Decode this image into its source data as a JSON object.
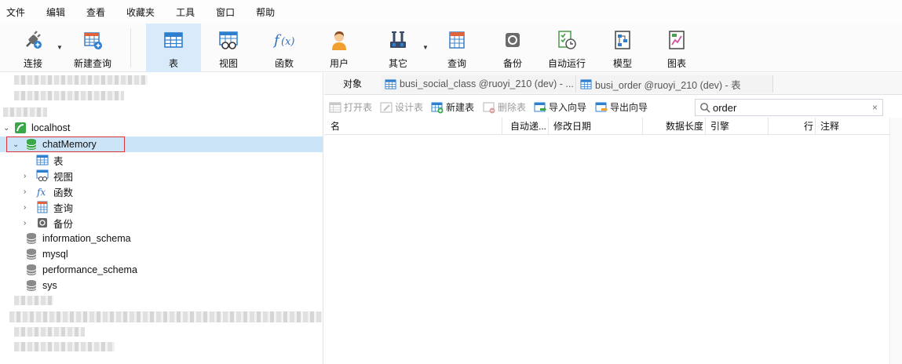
{
  "menu": [
    "文件",
    "编辑",
    "查看",
    "收藏夹",
    "工具",
    "窗口",
    "帮助"
  ],
  "toolbar": {
    "connect": "连接",
    "new_query": "新建查询",
    "table": "表",
    "view": "视图",
    "function": "函数",
    "user": "用户",
    "other": "其它",
    "query": "查询",
    "backup": "备份",
    "autorun": "自动运行",
    "model": "模型",
    "chart": "图表"
  },
  "tree": {
    "localhost": "localhost",
    "db_selected": "chatMemory",
    "children": [
      "表",
      "视图",
      "函数",
      "查询",
      "备份"
    ],
    "other_dbs": [
      "information_schema",
      "mysql",
      "performance_schema",
      "sys"
    ]
  },
  "tabs": {
    "object": "对象",
    "doc1": "busi_social_class @ruoyi_210 (dev) - ...",
    "doc2": "busi_order @ruoyi_210 (dev) - 表"
  },
  "subtoolbar": {
    "open_table": "打开表",
    "design_table": "设计表",
    "new_table": "新建表",
    "delete_table": "删除表",
    "import_wizard": "导入向导",
    "export_wizard": "导出向导"
  },
  "search": {
    "value": "order",
    "clear": "×"
  },
  "columns": [
    "名",
    "自动递...",
    "修改日期",
    "数据长度",
    "引擎",
    "行",
    "注释"
  ],
  "colors": {
    "accent": "#d9ebfa",
    "selected_row": "#cce4f7",
    "highlight_border": "#d9343b"
  }
}
